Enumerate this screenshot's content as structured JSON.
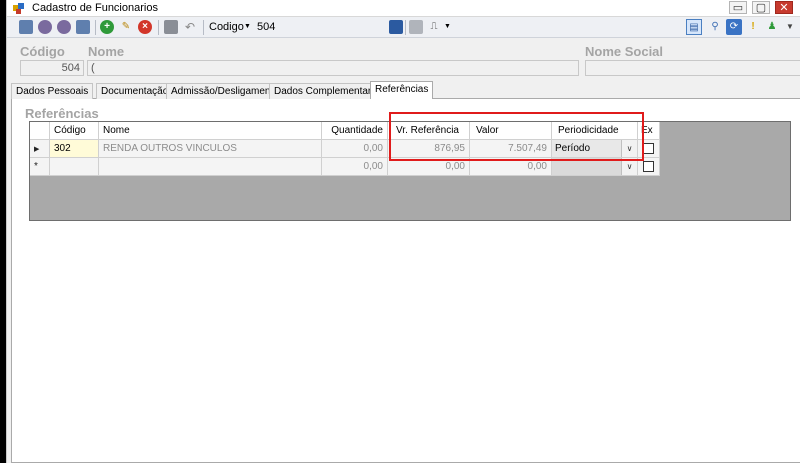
{
  "window": {
    "title": "Cadastro de Funcionarios",
    "controls": {
      "minimize": "▭",
      "maximize": "▢",
      "close": "✕"
    }
  },
  "toolbar": {
    "codigo_label": "Codigo",
    "codigo_value": "504",
    "icons": [
      "first-record-icon",
      "previous-record-icon",
      "next-record-icon",
      "last-record-icon",
      "add-icon",
      "edit-icon",
      "delete-icon",
      "save-icon",
      "undo-icon",
      "export-icon",
      "print-icon",
      "report-icon",
      "view-icon",
      "search-icon",
      "refresh-icon",
      "bulb-icon",
      "help-icon",
      "dropdown-icon"
    ]
  },
  "header": {
    "codigo_label": "Código",
    "codigo_value": "504",
    "nome_label": "Nome",
    "nome_value": "(",
    "nome_social_label": "Nome Social",
    "nome_social_value": ""
  },
  "tabs": [
    {
      "label": "Dados Pessoais",
      "active": false
    },
    {
      "label": "Documentação",
      "active": false
    },
    {
      "label": "Admissão/Desligamento",
      "active": false
    },
    {
      "label": "Dados Complementares",
      "active": false
    },
    {
      "label": "Referências",
      "active": true
    }
  ],
  "panel": {
    "title": "Referências"
  },
  "grid": {
    "columns": [
      "Código",
      "Nome",
      "Quantidade",
      "Vr. Referência",
      "Valor",
      "Periodicidade",
      "Ex"
    ],
    "rows": [
      {
        "indicator": "▶",
        "codigo": "302",
        "nome": "RENDA OUTROS VINCULOS",
        "quantidade": "0,00",
        "vr_referencia": "876,95",
        "valor": "7.507,49",
        "periodicidade": "Período",
        "ex": false
      },
      {
        "indicator": "*",
        "codigo": "",
        "nome": "",
        "quantidade": "0,00",
        "vr_referencia": "0,00",
        "valor": "0,00",
        "periodicidade": "",
        "ex": false
      }
    ]
  },
  "colors": {
    "highlight": "#e01b1b",
    "grid_background": "#a9a9a9",
    "label_gray": "#a4a4a4",
    "selected_cell": "#fffbd8"
  }
}
